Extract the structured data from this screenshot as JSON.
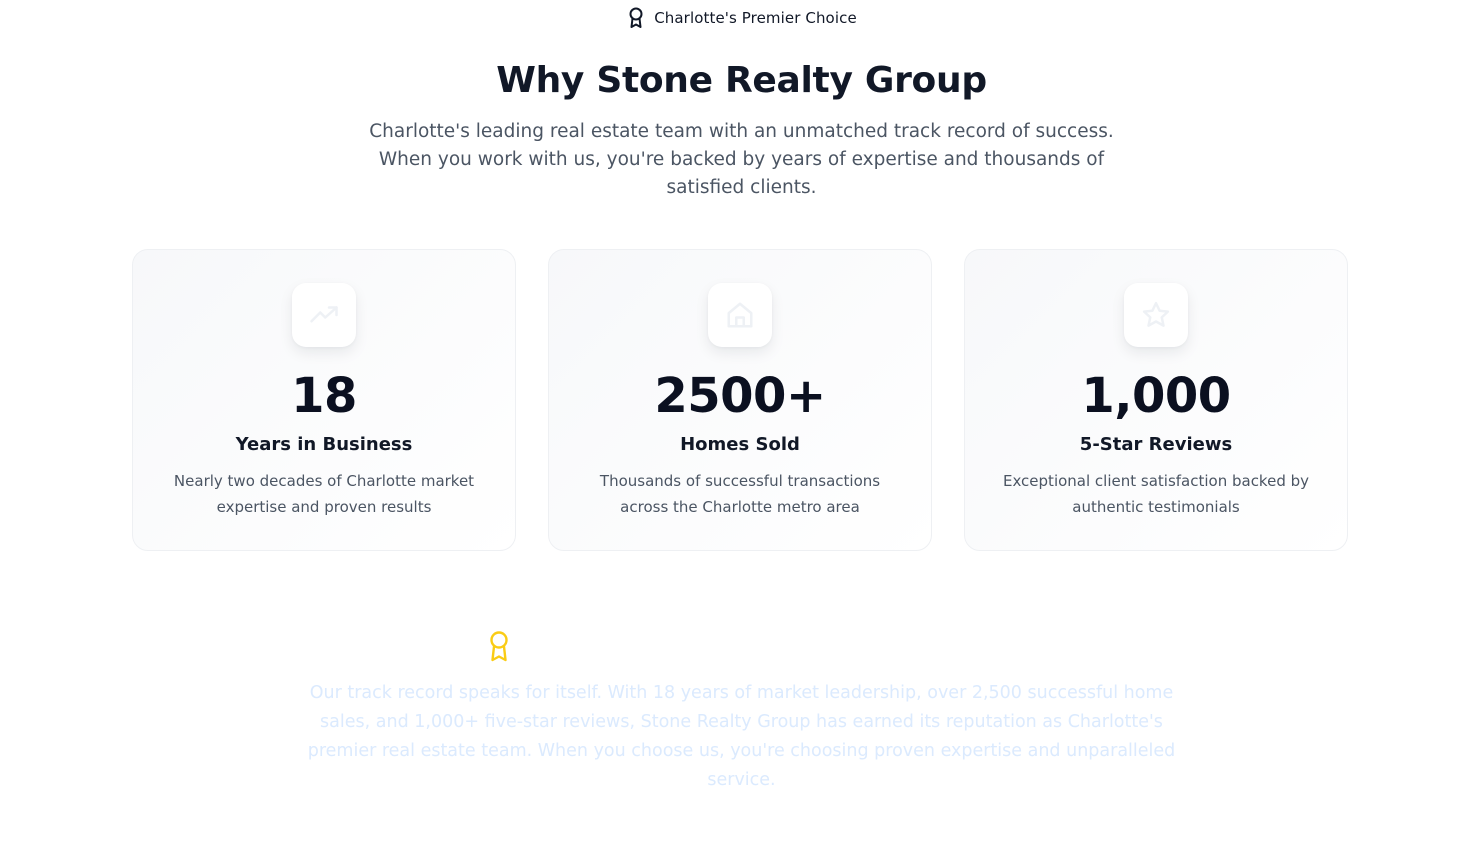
{
  "badge": {
    "icon": "award-ribbon-icon",
    "text": "Charlotte's Premier Choice"
  },
  "header": {
    "title": "Why Stone Realty Group",
    "subtitle": "Charlotte's leading real estate team with an unmatched track record of success. When you work with us, you're backed by years of expertise and thousands of satisfied clients."
  },
  "stats": [
    {
      "icon": "trending-up-icon",
      "value": "18",
      "label": "Years in Business",
      "description": "Nearly two decades of Charlotte market expertise and proven results"
    },
    {
      "icon": "home-icon",
      "value": "2500+",
      "label": "Homes Sold",
      "description": "Thousands of successful transactions across the Charlotte metro area"
    },
    {
      "icon": "star-icon",
      "value": "1,000",
      "label": "5-Star Reviews",
      "description": "Exceptional client satisfaction backed by authentic testimonials"
    }
  ],
  "closing": {
    "icon": "award-ribbon-icon",
    "text": "Our track record speaks for itself. With 18 years of market leadership, over 2,500 successful home sales, and 1,000+ five-star reviews, Stone Realty Group has earned its reputation as Charlotte's premier real estate team. When you choose us, you're choosing proven expertise and unparalleled service."
  },
  "colors": {
    "heading": "#111827",
    "body": "#4b5563",
    "award_accent": "#facc15",
    "closing_text": "#dbeafe"
  }
}
